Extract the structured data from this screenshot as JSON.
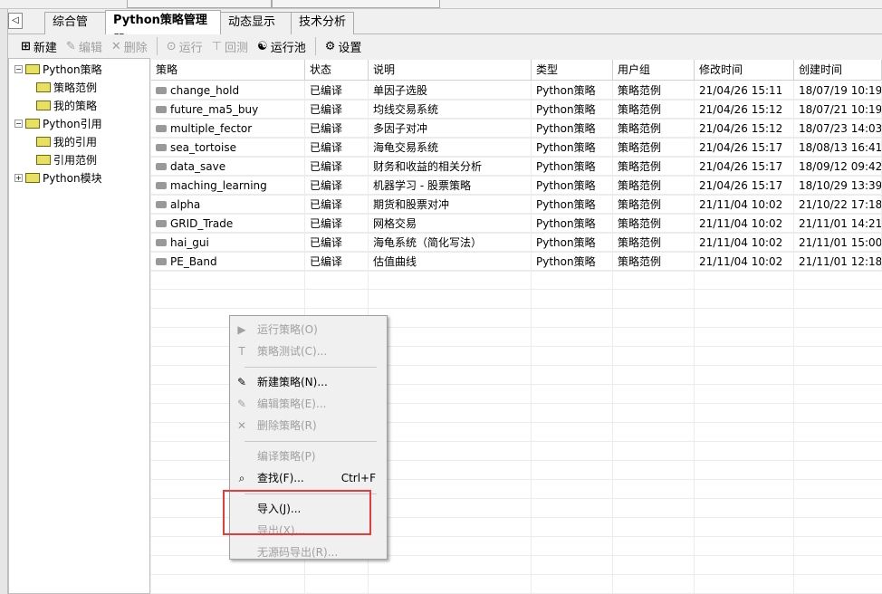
{
  "tabs": [
    "综合管理",
    "Python策略管理器",
    "动态显示牌",
    "技术分析"
  ],
  "toolbar": {
    "new": "新建",
    "edit": "编辑",
    "delete": "删除",
    "run": "运行",
    "backtest": "回测",
    "pool": "运行池",
    "settings": "设置"
  },
  "tree": [
    {
      "label": "Python策略",
      "level": 0,
      "expander": "−"
    },
    {
      "label": "策略范例",
      "level": 1
    },
    {
      "label": "我的策略",
      "level": 1
    },
    {
      "label": "Python引用",
      "level": 0,
      "expander": "−"
    },
    {
      "label": "我的引用",
      "level": 1
    },
    {
      "label": "引用范例",
      "level": 1
    },
    {
      "label": "Python模块",
      "level": 0,
      "expander": "+"
    }
  ],
  "table": {
    "headers": [
      "策略",
      "状态",
      "说明",
      "类型",
      "用户组",
      "修改时间",
      "创建时间"
    ],
    "rows": [
      [
        "change_hold",
        "已编译",
        "单因子选股",
        "Python策略",
        "策略范例",
        "21/04/26 15:11",
        "18/07/19 10:19"
      ],
      [
        "future_ma5_buy",
        "已编译",
        "均线交易系统",
        "Python策略",
        "策略范例",
        "21/04/26 15:12",
        "18/07/21 10:19"
      ],
      [
        "multiple_fector",
        "已编译",
        "多因子对冲",
        "Python策略",
        "策略范例",
        "21/04/26 15:12",
        "18/07/23 14:03"
      ],
      [
        "sea_tortoise",
        "已编译",
        "海龟交易系统",
        "Python策略",
        "策略范例",
        "21/04/26 15:17",
        "18/08/13 16:41"
      ],
      [
        "data_save",
        "已编译",
        "财务和收益的相关分析",
        "Python策略",
        "策略范例",
        "21/04/26 15:17",
        "18/09/12 09:42"
      ],
      [
        "maching_learning",
        "已编译",
        "机器学习 - 股票策略",
        "Python策略",
        "策略范例",
        "21/04/26 15:17",
        "18/10/29 13:39"
      ],
      [
        "alpha",
        "已编译",
        "期货和股票对冲",
        "Python策略",
        "策略范例",
        "21/11/04 10:02",
        "21/10/22 17:18"
      ],
      [
        "GRID_Trade",
        "已编译",
        "网格交易",
        "Python策略",
        "策略范例",
        "21/11/04 10:02",
        "21/11/01 14:21"
      ],
      [
        "hai_gui",
        "已编译",
        "海龟系统（简化写法）",
        "Python策略",
        "策略范例",
        "21/11/04 10:02",
        "21/11/01 15:00"
      ],
      [
        "PE_Band",
        "已编译",
        "估值曲线",
        "Python策略",
        "策略范例",
        "21/11/04 10:02",
        "21/11/01 12:18"
      ]
    ]
  },
  "context_menu": [
    {
      "label": "运行策略(O)",
      "disabled": true,
      "icon": "▶"
    },
    {
      "label": "策略测试(C)...",
      "disabled": true,
      "icon": "T"
    },
    {
      "sep": true
    },
    {
      "label": "新建策略(N)...",
      "disabled": false,
      "icon": "✎"
    },
    {
      "label": "编辑策略(E)...",
      "disabled": true,
      "icon": "✎"
    },
    {
      "label": "删除策略(R)",
      "disabled": true,
      "icon": "✕"
    },
    {
      "sep": true
    },
    {
      "label": "编译策略(P)",
      "disabled": true,
      "icon": ""
    },
    {
      "label": "查找(F)...",
      "disabled": false,
      "icon": "⌕",
      "shortcut": "Ctrl+F"
    },
    {
      "sep": true
    },
    {
      "label": "导入(J)...",
      "disabled": false,
      "icon": ""
    },
    {
      "label": "导出(X)...",
      "disabled": true,
      "icon": ""
    },
    {
      "label": "无源码导出(R)...",
      "disabled": true,
      "icon": ""
    }
  ]
}
